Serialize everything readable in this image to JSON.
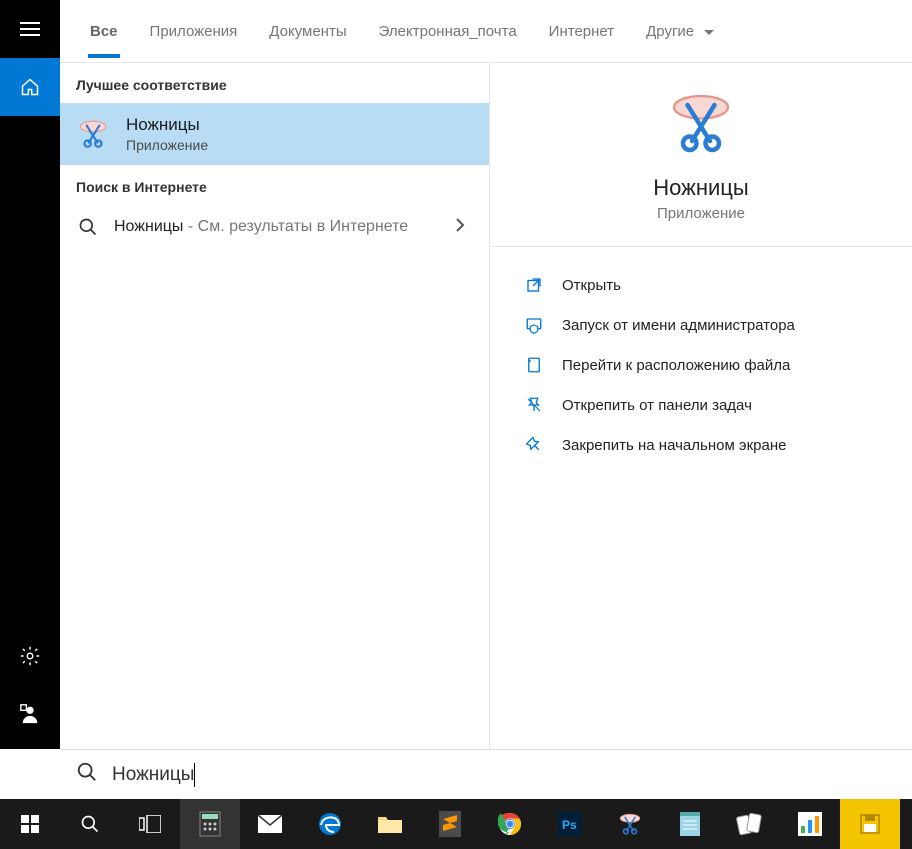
{
  "tabs": [
    {
      "label": "Все",
      "active": true
    },
    {
      "label": "Приложения"
    },
    {
      "label": "Документы"
    },
    {
      "label": "Электронная_почта"
    },
    {
      "label": "Интернет"
    },
    {
      "label": "Другие",
      "dropdown": true
    }
  ],
  "sections": {
    "best_match": "Лучшее соответствие",
    "web_search": "Поиск в Интернете"
  },
  "result": {
    "title": "Ножницы",
    "subtitle": "Приложение"
  },
  "web": {
    "query": "Ножницы",
    "suffix": " - См. результаты в Интернете"
  },
  "detail": {
    "title": "Ножницы",
    "subtitle": "Приложение",
    "actions": [
      {
        "icon": "open",
        "label": "Открыть"
      },
      {
        "icon": "admin",
        "label": "Запуск от имени администратора"
      },
      {
        "icon": "folder",
        "label": "Перейти к расположению файла"
      },
      {
        "icon": "unpin",
        "label": "Открепить от панели задач"
      },
      {
        "icon": "pin",
        "label": "Закрепить на начальном экране"
      }
    ]
  },
  "search_input": "Ножницы",
  "taskbar_icons": [
    "start",
    "search",
    "taskview",
    "calculator",
    "mail",
    "edge",
    "explorer",
    "sublime",
    "chrome",
    "photoshop",
    "snip",
    "notepad",
    "cards",
    "chart",
    "save"
  ],
  "colors": {
    "accent": "#0078d4",
    "selected": "#b9dcf5"
  }
}
